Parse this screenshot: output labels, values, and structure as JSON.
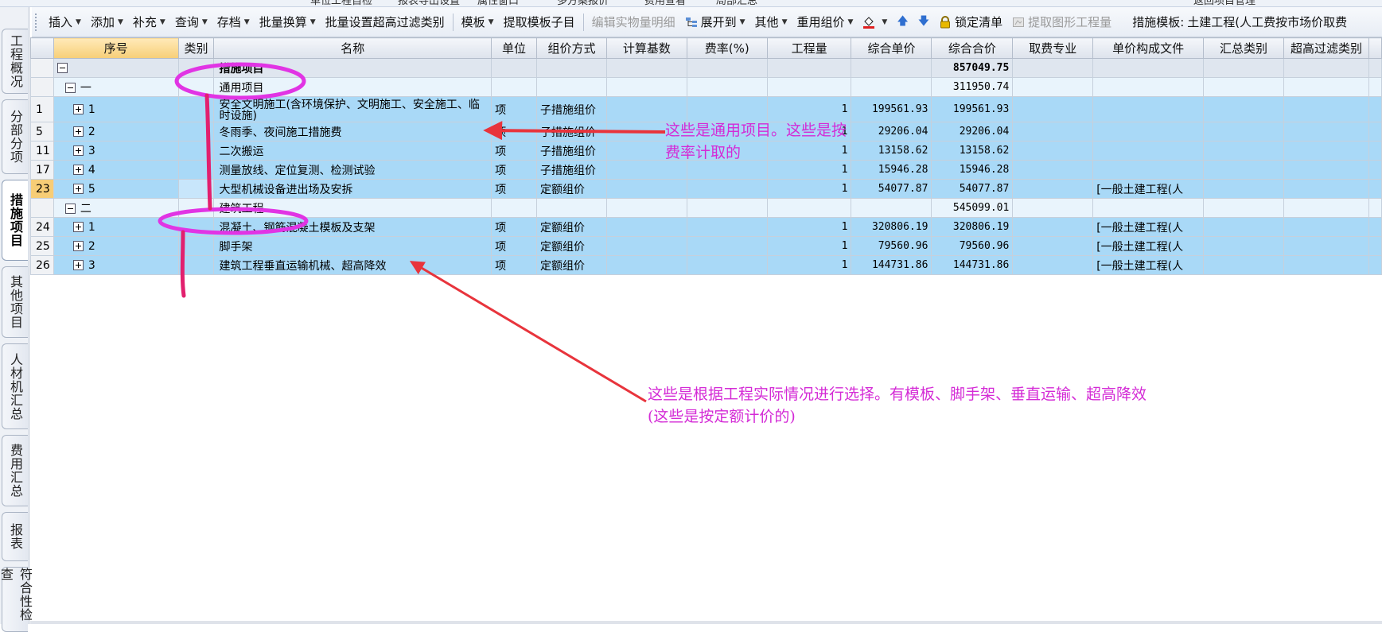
{
  "window": {
    "top_strip": [
      "单位工程自检",
      "报表导出设置",
      "属性窗口",
      "多方案报价",
      "费用查看",
      "局部汇总",
      "返回项目管理"
    ]
  },
  "toolbar": {
    "items": [
      {
        "label": "插入",
        "dropdown": true,
        "enabled": true
      },
      {
        "label": "添加",
        "dropdown": true,
        "enabled": true
      },
      {
        "label": "补充",
        "dropdown": true,
        "enabled": true
      },
      {
        "label": "查询",
        "dropdown": true,
        "enabled": true
      },
      {
        "label": "存档",
        "dropdown": true,
        "enabled": true
      },
      {
        "label": "批量换算",
        "dropdown": true,
        "enabled": true
      },
      {
        "label": "批量设置超高过滤类别",
        "dropdown": false,
        "enabled": true
      },
      {
        "label": "模板",
        "dropdown": true,
        "enabled": true
      },
      {
        "label": "提取模板子目",
        "dropdown": false,
        "enabled": true
      },
      {
        "label": "编辑实物量明细",
        "dropdown": false,
        "enabled": false
      },
      {
        "label": "展开到",
        "dropdown": true,
        "enabled": true
      },
      {
        "label": "其他",
        "dropdown": true,
        "enabled": true
      },
      {
        "label": "重用组价",
        "dropdown": true,
        "enabled": true
      },
      {
        "label": "锁定清单",
        "dropdown": false,
        "enabled": true
      },
      {
        "label": "提取图形工程量",
        "dropdown": false,
        "enabled": false
      }
    ],
    "template_label": "措施模板:",
    "template_value": "土建工程(人工费按市场价取费"
  },
  "left_tabs": [
    {
      "label": "工程概况",
      "active": false
    },
    {
      "label": "分部分项",
      "active": false
    },
    {
      "label": "措施项目",
      "active": true
    },
    {
      "label": "其他项目",
      "active": false
    },
    {
      "label": "人材机汇总",
      "active": false
    },
    {
      "label": "费用汇总",
      "active": false
    },
    {
      "label": "报表",
      "active": false
    },
    {
      "label": "符合性检查",
      "active": false
    }
  ],
  "grid": {
    "columns": [
      "序号",
      "类别",
      "名称",
      "单位",
      "组价方式",
      "计算基数",
      "费率(%)",
      "工程量",
      "综合单价",
      "综合合价",
      "取费专业",
      "单价构成文件",
      "汇总类别",
      "超高过滤类别"
    ],
    "rows": [
      {
        "kind": "sum",
        "row_no": "",
        "level": 0,
        "expander": "minus",
        "seq": "",
        "name": "措施项目",
        "unit": "",
        "method": "",
        "base": "",
        "rate": "",
        "qty": "",
        "unit_price": "",
        "total": "857049.75",
        "fee": "",
        "price_file": ""
      },
      {
        "kind": "group",
        "row_no": "",
        "level": 1,
        "expander": "minus",
        "seq": "一",
        "name": "通用项目",
        "unit": "",
        "method": "",
        "base": "",
        "rate": "",
        "qty": "",
        "unit_price": "",
        "total": "311950.74",
        "fee": "",
        "price_file": ""
      },
      {
        "kind": "item",
        "row_no": "1",
        "level": 2,
        "expander": "plus",
        "seq": "1",
        "name": "安全文明施工(含环境保护、文明施工、安全施工、临时设施)",
        "unit": "项",
        "method": "子措施组价",
        "base": "",
        "rate": "",
        "qty": "1",
        "unit_price": "199561.93",
        "total": "199561.93",
        "fee": "",
        "price_file": ""
      },
      {
        "kind": "item",
        "row_no": "5",
        "level": 2,
        "expander": "plus",
        "seq": "2",
        "name": "冬雨季、夜间施工措施费",
        "unit": "项",
        "method": "子措施组价",
        "base": "",
        "rate": "",
        "qty": "1",
        "unit_price": "29206.04",
        "total": "29206.04",
        "fee": "",
        "price_file": ""
      },
      {
        "kind": "item",
        "row_no": "11",
        "level": 2,
        "expander": "plus",
        "seq": "3",
        "name": "二次搬运",
        "unit": "项",
        "method": "子措施组价",
        "base": "",
        "rate": "",
        "qty": "1",
        "unit_price": "13158.62",
        "total": "13158.62",
        "fee": "",
        "price_file": ""
      },
      {
        "kind": "item",
        "row_no": "17",
        "level": 2,
        "expander": "plus",
        "seq": "4",
        "name": "测量放线、定位复测、检测试验",
        "unit": "项",
        "method": "子措施组价",
        "base": "",
        "rate": "",
        "qty": "1",
        "unit_price": "15946.28",
        "total": "15946.28",
        "fee": "",
        "price_file": ""
      },
      {
        "kind": "item",
        "row_no": "23",
        "level": 2,
        "expander": "plus",
        "seq": "5",
        "name": "大型机械设备进出场及安拆",
        "unit": "项",
        "method": "定额组价",
        "base": "",
        "rate": "",
        "qty": "1",
        "unit_price": "54077.87",
        "total": "54077.87",
        "fee": "",
        "price_file": "[一般土建工程(人",
        "selected": true
      },
      {
        "kind": "group",
        "row_no": "",
        "level": 1,
        "expander": "minus",
        "seq": "二",
        "name": "建筑工程",
        "unit": "",
        "method": "",
        "base": "",
        "rate": "",
        "qty": "",
        "unit_price": "",
        "total": "545099.01",
        "fee": "",
        "price_file": ""
      },
      {
        "kind": "item",
        "row_no": "24",
        "level": 2,
        "expander": "plus",
        "seq": "1",
        "name": "混凝土、钢筋混凝土模板及支架",
        "unit": "项",
        "method": "定额组价",
        "base": "",
        "rate": "",
        "qty": "1",
        "unit_price": "320806.19",
        "total": "320806.19",
        "fee": "",
        "price_file": "[一般土建工程(人"
      },
      {
        "kind": "item",
        "row_no": "25",
        "level": 2,
        "expander": "plus",
        "seq": "2",
        "name": "脚手架",
        "unit": "项",
        "method": "定额组价",
        "base": "",
        "rate": "",
        "qty": "1",
        "unit_price": "79560.96",
        "total": "79560.96",
        "fee": "",
        "price_file": "[一般土建工程(人"
      },
      {
        "kind": "item",
        "row_no": "26",
        "level": 2,
        "expander": "plus",
        "seq": "3",
        "name": "建筑工程垂直运输机械、超高降效",
        "unit": "项",
        "method": "定额组价",
        "base": "",
        "rate": "",
        "qty": "1",
        "unit_price": "144731.86",
        "total": "144731.86",
        "fee": "",
        "price_file": "[一般土建工程(人"
      }
    ]
  },
  "annotations": {
    "color": "#d42bd6",
    "arrow_color": "#e8343c",
    "note1_lines": [
      "这些是通用项目。这些是按",
      "费率计取的"
    ],
    "note2_lines": [
      "这些是根据工程实际情况进行选择。有模板、脚手架、垂直运输、超高降效",
      "(这些是按定额计价的)"
    ]
  }
}
